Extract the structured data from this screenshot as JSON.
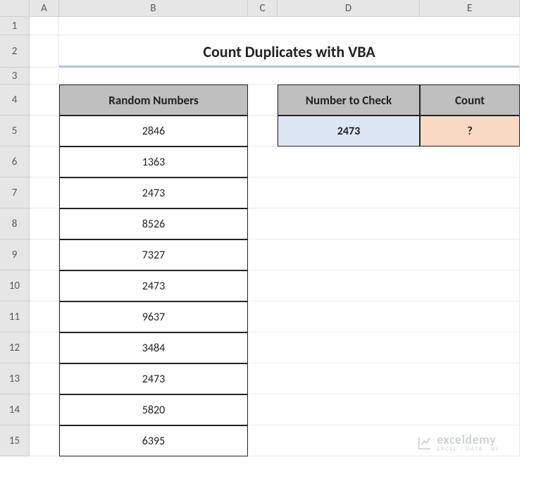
{
  "columns": [
    "A",
    "B",
    "C",
    "D",
    "E"
  ],
  "rows": [
    "1",
    "2",
    "3",
    "4",
    "5",
    "6",
    "7",
    "8",
    "9",
    "10",
    "11",
    "12",
    "13",
    "14",
    "15"
  ],
  "title": "Count Duplicates with VBA",
  "headers": {
    "random": "Random Numbers",
    "check": "Number to Check",
    "count": "Count"
  },
  "random_numbers": [
    "2846",
    "1363",
    "2473",
    "8526",
    "7327",
    "2473",
    "9637",
    "3484",
    "2473",
    "5820",
    "6395"
  ],
  "check_value": "2473",
  "count_value": "?",
  "watermark": {
    "name": "exceldemy",
    "tagline": "EXCEL · DATA · BI"
  },
  "chart_data": {
    "type": "table",
    "title": "Count Duplicates with VBA",
    "tables": [
      {
        "name": "Random Numbers",
        "columns": [
          "Random Numbers"
        ],
        "rows": [
          [
            2846
          ],
          [
            1363
          ],
          [
            2473
          ],
          [
            8526
          ],
          [
            7327
          ],
          [
            2473
          ],
          [
            9637
          ],
          [
            3484
          ],
          [
            2473
          ],
          [
            5820
          ],
          [
            6395
          ]
        ]
      },
      {
        "name": "Check",
        "columns": [
          "Number to Check",
          "Count"
        ],
        "rows": [
          [
            2473,
            "?"
          ]
        ]
      }
    ]
  }
}
